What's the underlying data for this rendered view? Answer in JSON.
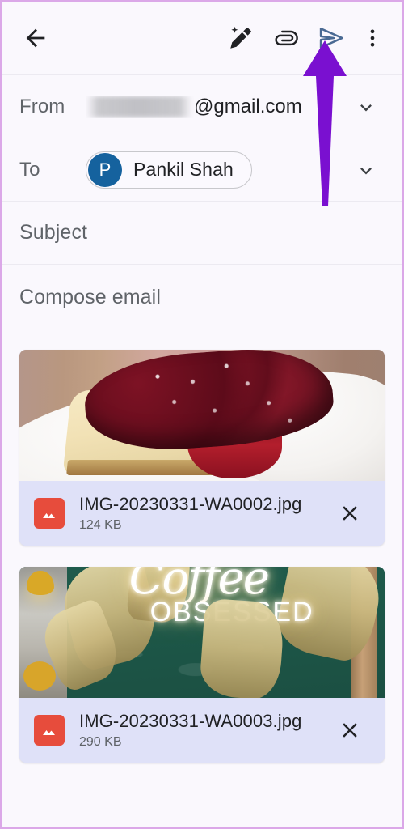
{
  "app": {
    "screen_name": "Gmail compose"
  },
  "toolbar": {
    "back_label": "Back",
    "items": [
      {
        "name": "magic-compose-icon",
        "label": "Help me write"
      },
      {
        "name": "paperclip-icon",
        "label": "Attach file"
      },
      {
        "name": "send-icon",
        "label": "Send"
      },
      {
        "name": "more-options-icon",
        "label": "More options"
      }
    ]
  },
  "fields": {
    "from": {
      "label": "From",
      "value_suffix": "@gmail.com",
      "value_redacted": true,
      "expand_label": "Expand"
    },
    "to": {
      "label": "To",
      "chip": {
        "initial": "P",
        "name": "Pankil Shah"
      },
      "expand_label": "Expand"
    },
    "subject": {
      "placeholder": "Subject"
    },
    "body": {
      "placeholder": "Compose email"
    }
  },
  "attachments": [
    {
      "file_name": "IMG-20230331-WA0002.jpg",
      "file_size": "124 KB",
      "remove_label": "Remove attachment",
      "thumb_alt": "Slice of cheesecake with dark red cherry topping on a white plate"
    },
    {
      "file_name": "IMG-20230331-WA0003.jpg",
      "file_size": "290 KB",
      "remove_label": "Remove attachment",
      "thumb_alt": "Green cafe wall with Coffee Obsessed neon sign and dried pampas grass",
      "neon_script": "Coffee",
      "neon_caps": "OBSESSED"
    }
  ],
  "annotation": {
    "type": "arrow",
    "points_at": "send-icon",
    "color": "#7a10d0"
  },
  "colors": {
    "page_bg": "#faf8fd",
    "page_border": "#dba8e8",
    "attachment_bar": "#dfe1f8",
    "avatar": "#15629e",
    "send_icon": "#4a6a93",
    "file_icon": "#e74c3c",
    "annotation": "#7a10d0"
  }
}
